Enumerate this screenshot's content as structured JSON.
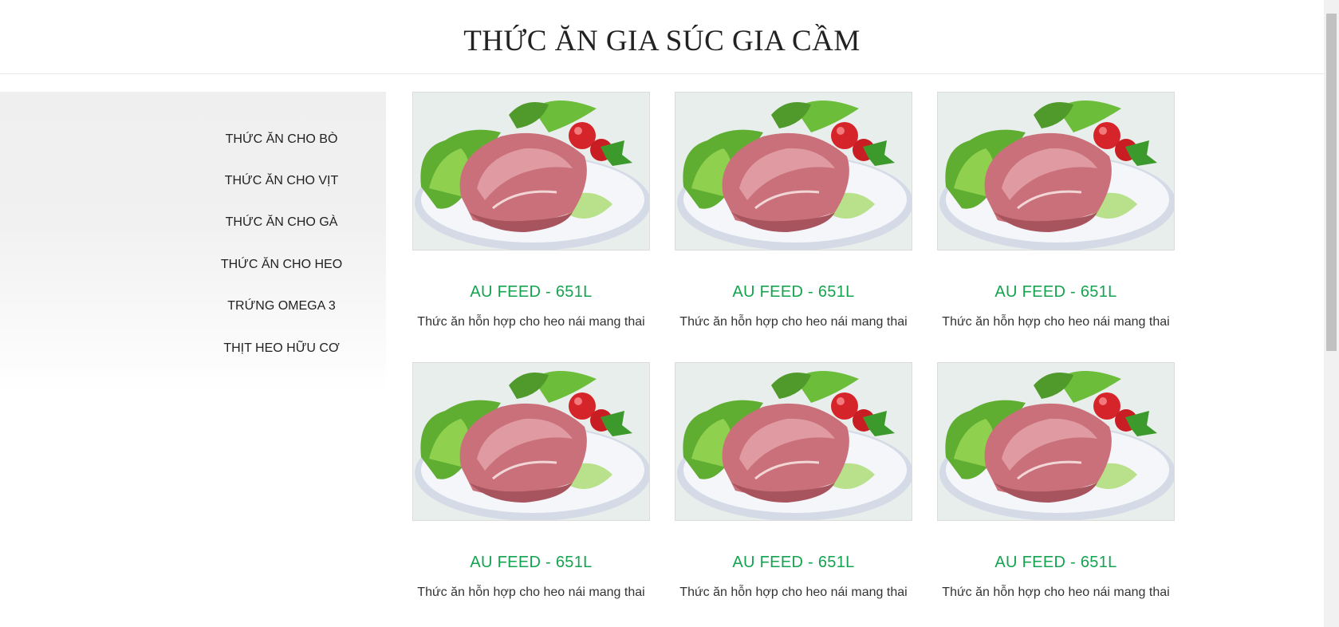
{
  "header": {
    "title": "THỨC ĂN GIA SÚC GIA CẦM"
  },
  "sidebar": {
    "items": [
      {
        "label": "THỨC ĂN CHO BÒ"
      },
      {
        "label": "THỨC ĂN CHO VỊT"
      },
      {
        "label": "THỨC ĂN CHO GÀ"
      },
      {
        "label": "THỨC ĂN CHO HEO"
      },
      {
        "label": "TRỨNG OMEGA 3"
      },
      {
        "label": "THỊT HEO HỮU CƠ"
      }
    ]
  },
  "products": [
    {
      "name": "AU FEED - 651L",
      "description": "Thức ăn hỗn hợp cho heo nái mang thai",
      "image": "pork-on-plate-image"
    },
    {
      "name": "AU FEED - 651L",
      "description": "Thức ăn hỗn hợp cho heo nái mang thai",
      "image": "pork-on-plate-image"
    },
    {
      "name": "AU FEED - 651L",
      "description": "Thức ăn hỗn hợp cho heo nái mang thai",
      "image": "pork-on-plate-image"
    },
    {
      "name": "AU FEED - 651L",
      "description": "Thức ăn hỗn hợp cho heo nái mang thai",
      "image": "pork-on-plate-image"
    },
    {
      "name": "AU FEED - 651L",
      "description": "Thức ăn hỗn hợp cho heo nái mang thai",
      "image": "pork-on-plate-image"
    },
    {
      "name": "AU FEED - 651L",
      "description": "Thức ăn hỗn hợp cho heo nái mang thai",
      "image": "pork-on-plate-image"
    }
  ],
  "colors": {
    "product_name": "#14a34f",
    "sidebar_bg": "#efefef"
  }
}
